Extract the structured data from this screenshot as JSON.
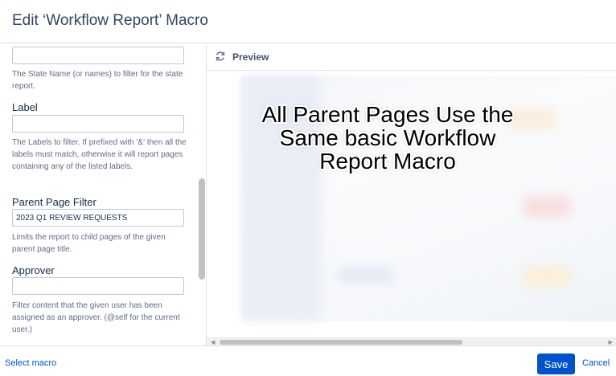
{
  "dialog": {
    "title": "Edit ‘Workflow Report’ Macro"
  },
  "form": {
    "state_name": {
      "value": "",
      "help": "The State Name (or names) to filter for the state report."
    },
    "label": {
      "label": "Label",
      "value": "",
      "help": "The Labels to filter. If prefixed with '&' then all the labels must match, otherwise it will report pages containing any of the listed labels."
    },
    "parent_page_filter": {
      "label": "Parent Page Filter",
      "value": "2023 Q1 REVIEW REQUESTS",
      "help": "Limits the report to child pages of the given parent page title."
    },
    "approver": {
      "label": "Approver",
      "value": "",
      "help": "Filter content that the given user has been assigned as an approver. (@self for the current user.)"
    }
  },
  "preview": {
    "label": "Preview",
    "overlay_text": "All Parent Pages Use the Same basic Workflow Report Macro"
  },
  "footer": {
    "select_macro": "Select macro",
    "save": "Save",
    "cancel": "Cancel"
  },
  "colors": {
    "primary": "#0052cc",
    "border": "#dfe1e6",
    "help_text": "#5e6c84"
  }
}
